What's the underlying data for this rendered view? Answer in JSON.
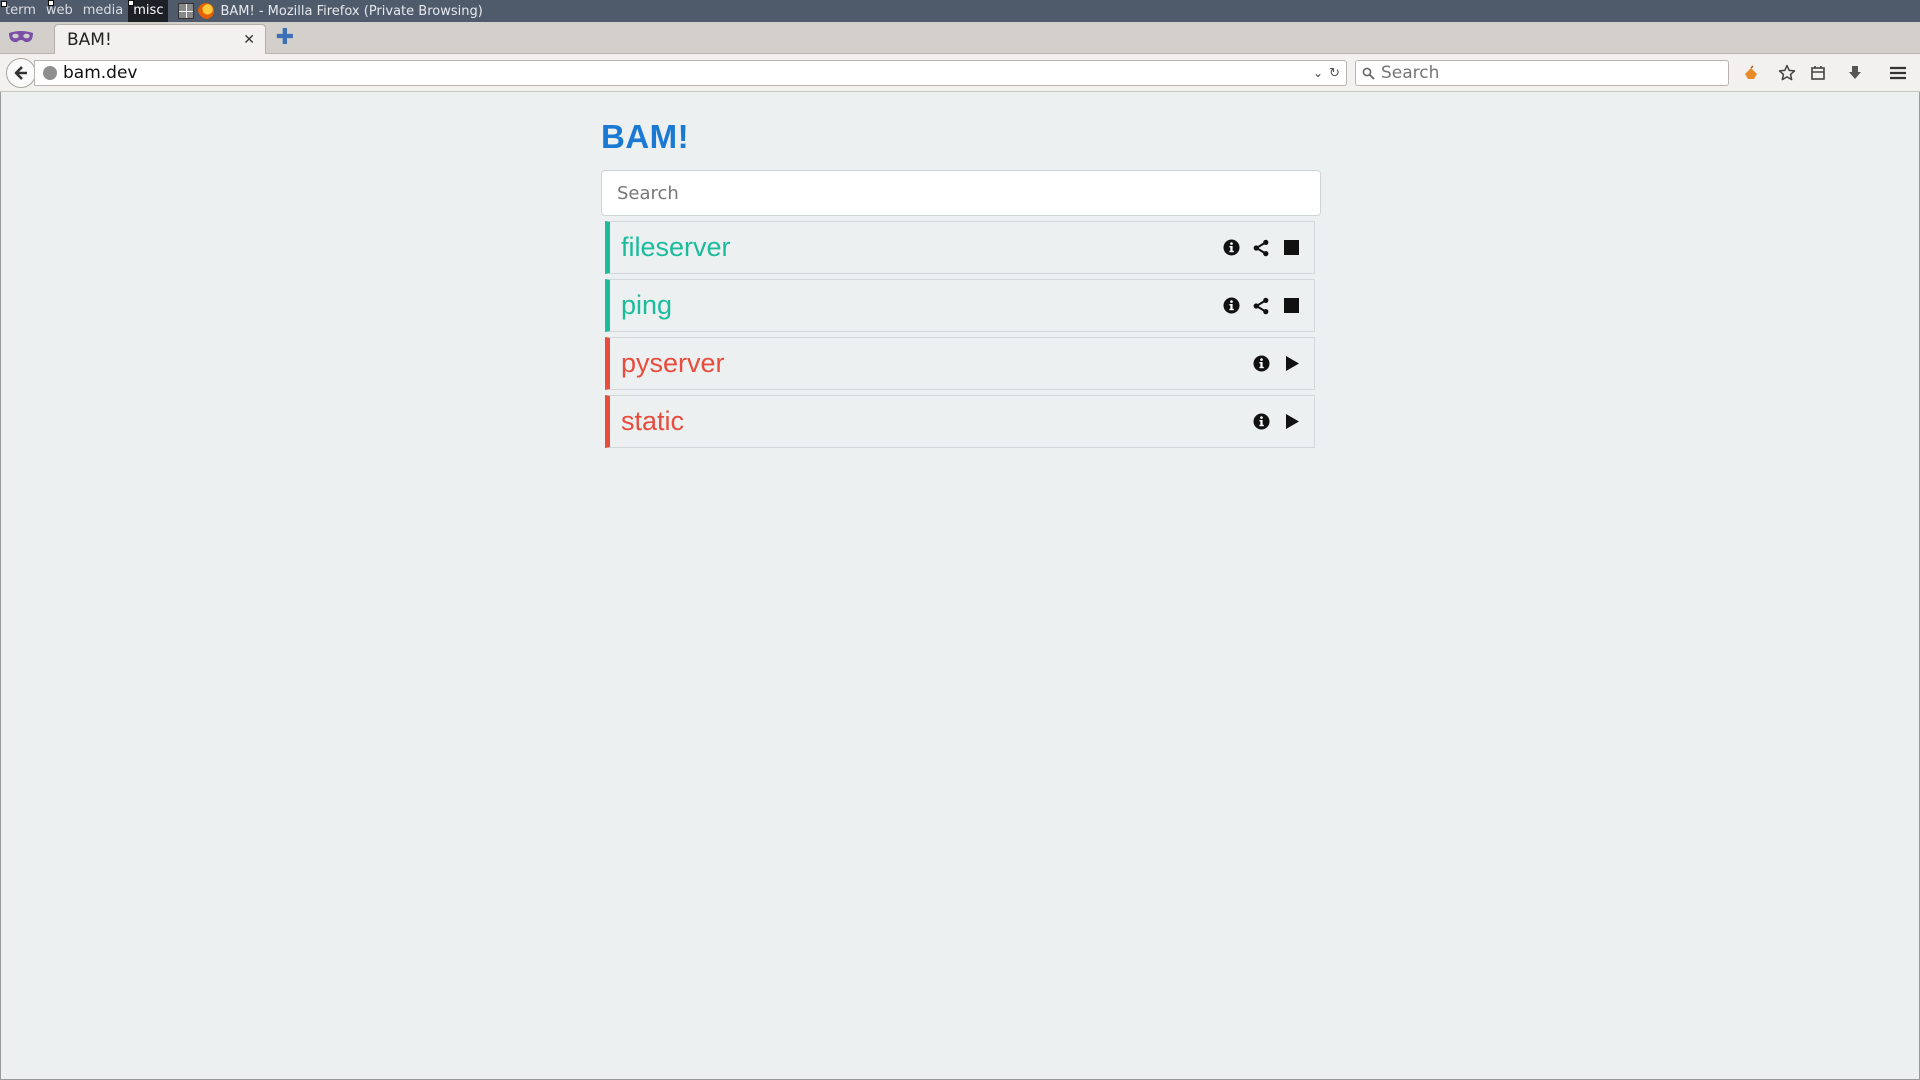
{
  "wm": {
    "workspaces": [
      "term",
      "web",
      "media",
      "misc"
    ],
    "window_title": "BAM! - Mozilla Firefox (Private Browsing)"
  },
  "browser": {
    "tab_title": "BAM!",
    "url": "bam.dev",
    "search_placeholder": "Search"
  },
  "page": {
    "brand": "BAM!",
    "search_placeholder": "Search",
    "services": [
      {
        "name": "fileserver",
        "status": "running"
      },
      {
        "name": "ping",
        "status": "running"
      },
      {
        "name": "pyserver",
        "status": "stopped"
      },
      {
        "name": "static",
        "status": "stopped"
      }
    ]
  },
  "colors": {
    "running": "#1abc9c",
    "stopped": "#e74c3c",
    "brand": "#1a7ad3"
  }
}
